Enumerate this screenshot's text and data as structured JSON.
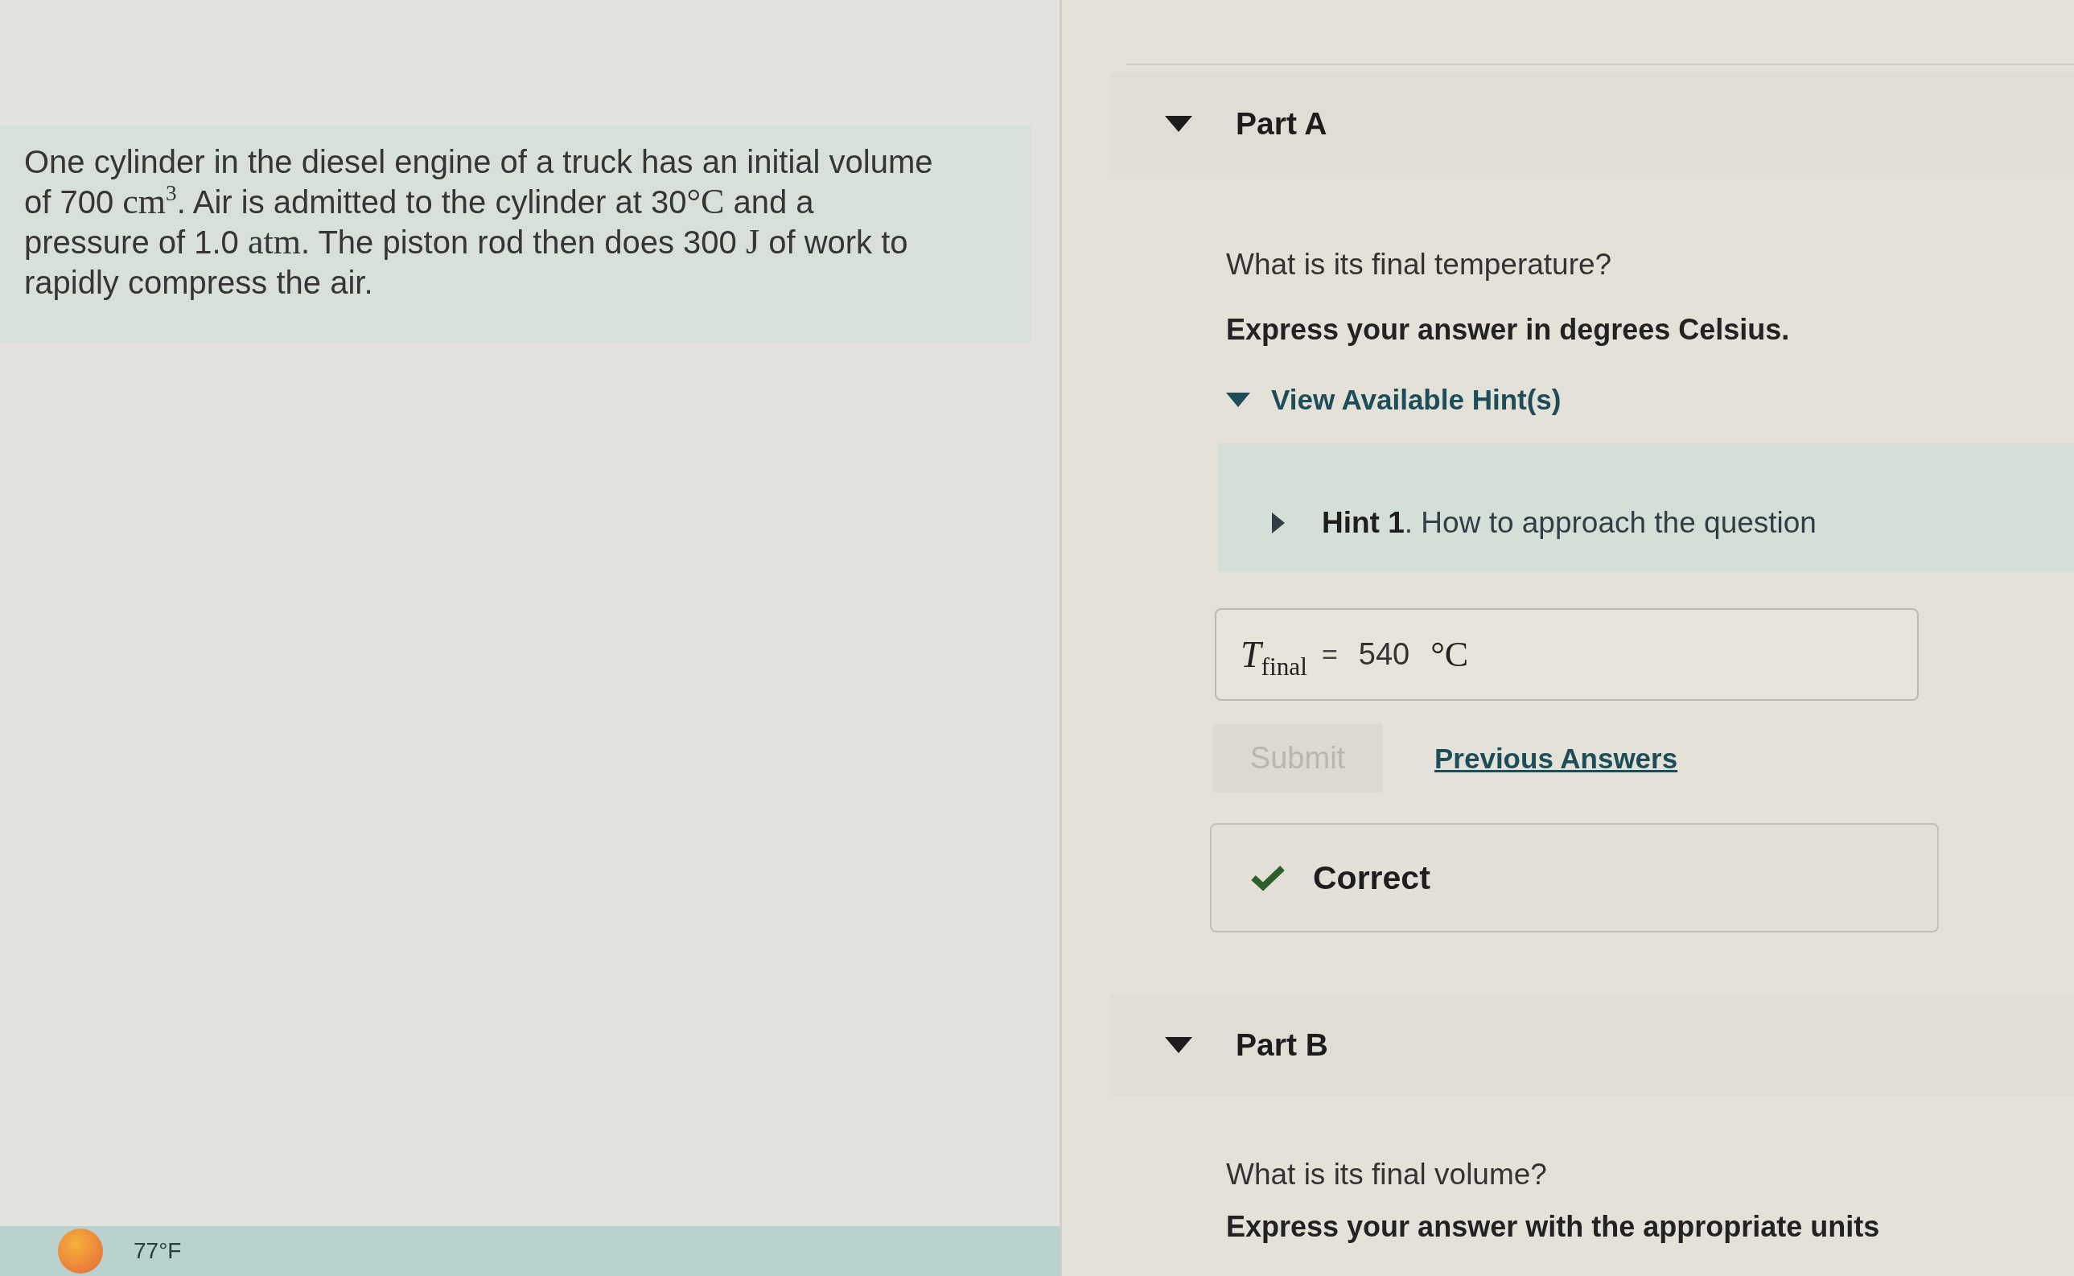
{
  "problem": {
    "segments": [
      {
        "kind": "text",
        "text": "One cylinder in the diesel engine of a truck has an initial volume of 700 "
      },
      {
        "kind": "math",
        "text": "cm$^{3}$"
      },
      {
        "kind": "text",
        "text": ". Air is admitted to the cylinder at 30"
      },
      {
        "kind": "math",
        "text": "°C"
      },
      {
        "kind": "text",
        "text": " and a pressure of 1.0 "
      },
      {
        "kind": "math",
        "text": "atm"
      },
      {
        "kind": "text",
        "text": ". The piston rod then does 300 "
      },
      {
        "kind": "math",
        "text": "J"
      },
      {
        "kind": "text",
        "text": " of work to rapidly compress the air."
      }
    ]
  },
  "taskbar": {
    "temperature": "77°F"
  },
  "parts": [
    {
      "title": "Part A",
      "expanded": true,
      "question": "What is its final temperature?",
      "instruction": "Express your answer in degrees Celsius.",
      "hints": {
        "label": "View Available Hint(s)",
        "expanded": true,
        "items": [
          {
            "title": "**Hint 1**. How to approach the question",
            "expanded": false
          }
        ]
      },
      "answer": {
        "variable": "*T*$_{final}$",
        "equals": "=",
        "value": "540",
        "unit": "°C"
      },
      "submit": {
        "label": "Submit",
        "disabled": true
      },
      "previous_answers": "Previous Answers",
      "feedback": {
        "kind": "correct",
        "text": "Correct"
      }
    },
    {
      "title": "Part B",
      "expanded": true,
      "question": "What is its final volume?",
      "instruction": "Express your answer with the appropriate units"
    }
  ]
}
